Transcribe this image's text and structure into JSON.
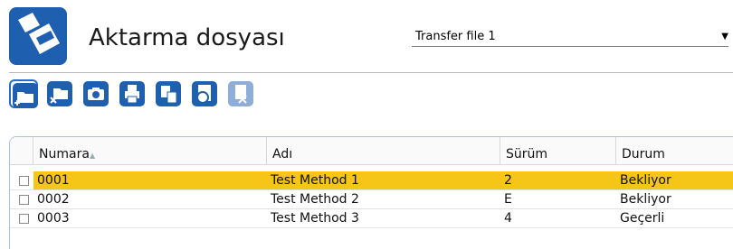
{
  "header": {
    "title": "Aktarma dosyası"
  },
  "transfer_select": {
    "value": "Transfer file 1"
  },
  "toolbar": {
    "buttons": [
      {
        "icon": "new-folder-icon"
      },
      {
        "icon": "delete-folder-icon"
      },
      {
        "icon": "camera-icon"
      },
      {
        "icon": "print-icon"
      },
      {
        "icon": "copy-icon"
      },
      {
        "icon": "refresh-icon"
      },
      {
        "icon": "delete-file-icon"
      }
    ]
  },
  "table": {
    "columns": [
      "Numara",
      "Adı",
      "Sürüm",
      "Durum"
    ],
    "rows": [
      {
        "numara": "0001",
        "adi": "Test Method 1",
        "surum": "2",
        "durum": "Bekliyor",
        "selected": true
      },
      {
        "numara": "0002",
        "adi": "Test Method 2",
        "surum": "E",
        "durum": "Bekliyor",
        "selected": false
      },
      {
        "numara": "0003",
        "adi": "Test Method 3",
        "surum": "4",
        "durum": "Geçerli",
        "selected": false
      }
    ]
  },
  "colors": {
    "accent": "#1f5fb0",
    "selection": "#f5c518"
  }
}
